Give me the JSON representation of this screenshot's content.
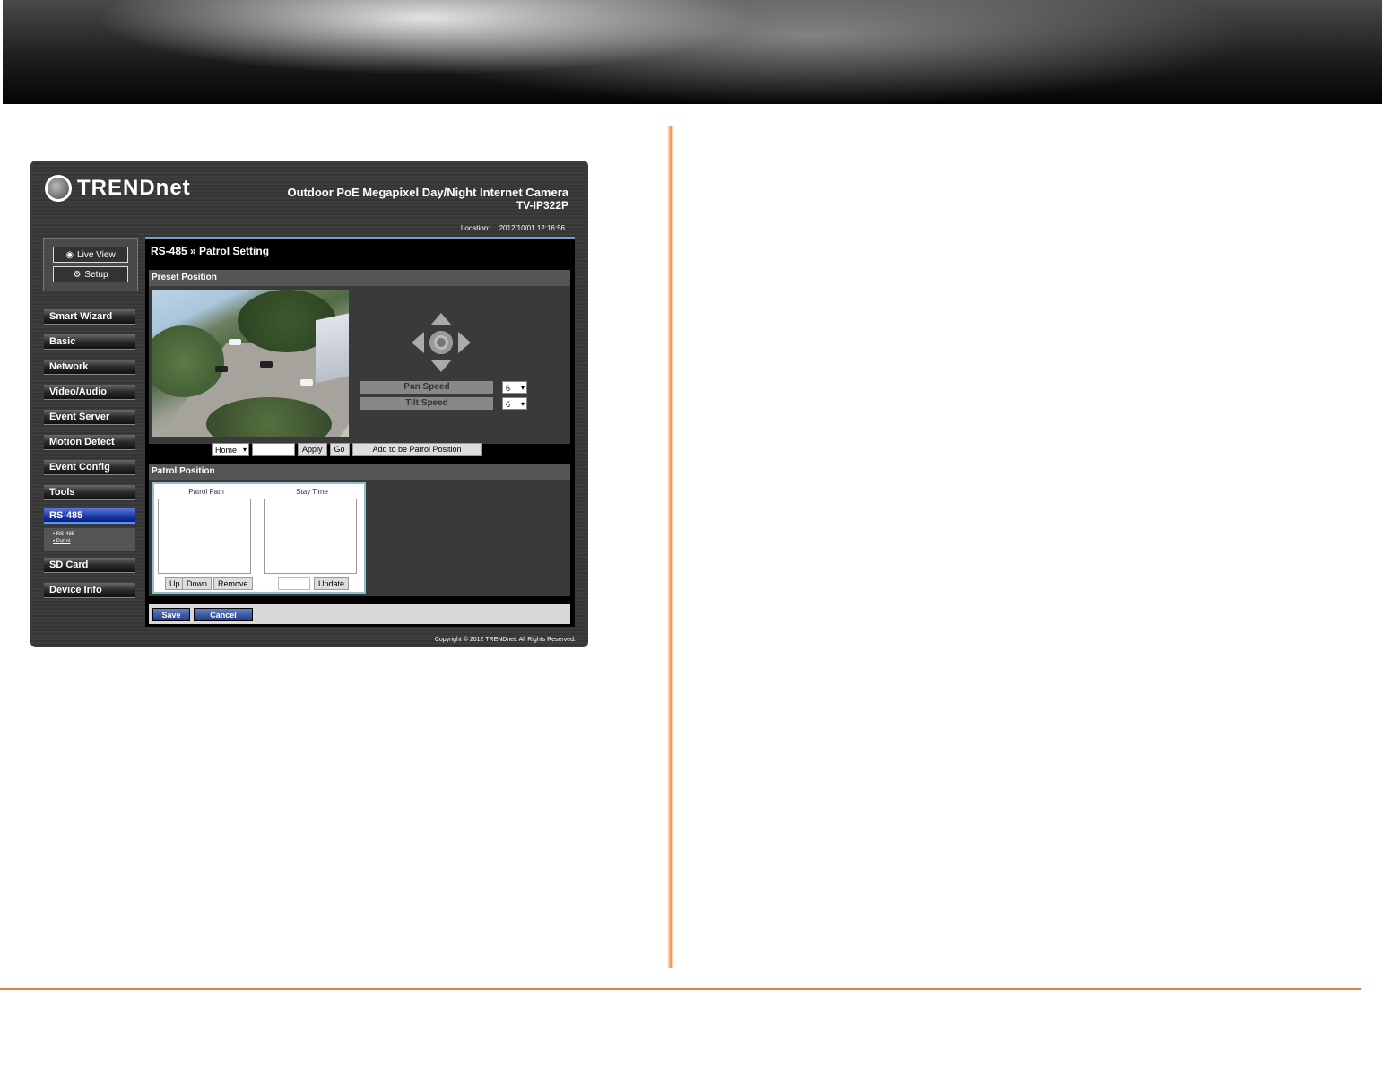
{
  "brand": {
    "logo_text": "TRENDnet"
  },
  "product": {
    "title": "Outdoor PoE Megapixel Day/Night Internet Camera",
    "model": "TV-IP322P"
  },
  "location": {
    "label": "Location:",
    "datetime": "2012/10/01 12:16:56"
  },
  "mode_buttons": {
    "live_view": "Live View",
    "setup": "Setup"
  },
  "nav": {
    "items": [
      "Smart Wizard",
      "Basic",
      "Network",
      "Video/Audio",
      "Event Server",
      "Motion Detect",
      "Event Config",
      "Tools",
      "RS-485",
      "SD Card",
      "Device Info"
    ],
    "active": "RS-485",
    "submenu": [
      "• RS-485",
      "• Patrol"
    ]
  },
  "page": {
    "title": "RS-485 » Patrol Setting"
  },
  "preset": {
    "section_title": "Preset Position",
    "pan_speed_label": "Pan Speed",
    "pan_speed_value": "6",
    "tilt_speed_label": "Tilt Speed",
    "tilt_speed_value": "6",
    "preset_select": "Home",
    "apply_label": "Apply",
    "go_label": "Go",
    "add_label": "Add to be Patrol Position"
  },
  "patrol": {
    "section_title": "Patrol Position",
    "path_header": "Patrol Path",
    "stay_header": "Stay Time",
    "up_label": "Up",
    "down_label": "Down",
    "remove_label": "Remove",
    "update_label": "Update"
  },
  "actions": {
    "save": "Save",
    "cancel": "Cancel"
  },
  "copyright": "Copyright © 2012 TRENDnet. All Rights Reserved.",
  "colors": {
    "accent_orange": "#e0803c",
    "nav_active": "#1e3cae"
  }
}
